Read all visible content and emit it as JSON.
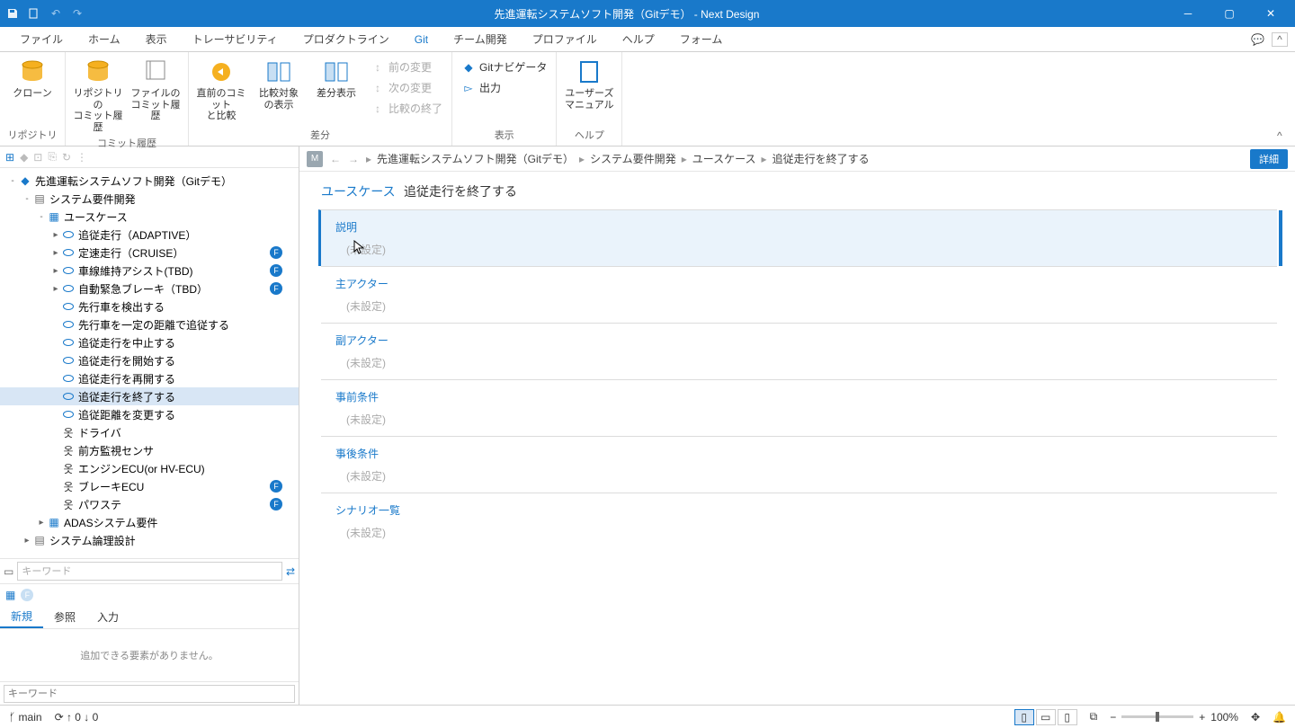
{
  "window": {
    "title": "先進運転システムソフト開発（Gitデモ） - Next Design"
  },
  "menu": {
    "tabs": [
      "ファイル",
      "ホーム",
      "表示",
      "トレーサビリティ",
      "プロダクトライン",
      "Git",
      "チーム開発",
      "プロファイル",
      "ヘルプ",
      "フォーム"
    ],
    "active": 5
  },
  "ribbon": {
    "groups": [
      {
        "label": "リポジトリ",
        "big": [
          {
            "label": "クローン"
          }
        ]
      },
      {
        "label": "コミット履歴",
        "big": [
          {
            "label": "リポジトリの\nコミット履歴"
          },
          {
            "label": "ファイルの\nコミット履歴"
          }
        ]
      },
      {
        "label": "差分",
        "big": [
          {
            "label": "直前のコミット\nと比較"
          },
          {
            "label": "比較対象\nの表示"
          },
          {
            "label": "差分表示"
          }
        ],
        "small": [
          {
            "label": "前の変更",
            "disabled": true
          },
          {
            "label": "次の変更",
            "disabled": true
          },
          {
            "label": "比較の終了",
            "disabled": true
          }
        ]
      },
      {
        "label": "表示",
        "small": [
          {
            "label": "Gitナビゲータ"
          },
          {
            "label": "出力"
          }
        ]
      },
      {
        "label": "ヘルプ",
        "big": [
          {
            "label": "ユーザーズ\nマニュアル"
          }
        ]
      }
    ]
  },
  "tree": [
    {
      "d": 0,
      "tw": "-",
      "ic": "proj",
      "label": "先進運転システムソフト開発（Gitデモ）"
    },
    {
      "d": 1,
      "tw": "-",
      "ic": "folder",
      "label": "システム要件開発"
    },
    {
      "d": 2,
      "tw": "-",
      "ic": "box",
      "label": "ユースケース"
    },
    {
      "d": 3,
      "tw": "▸",
      "ic": "oval",
      "label": "追従走行（ADAPTIVE）"
    },
    {
      "d": 3,
      "tw": "▸",
      "ic": "oval",
      "label": "定速走行（CRUISE）",
      "badge": "F"
    },
    {
      "d": 3,
      "tw": "▸",
      "ic": "oval",
      "label": "車線維持アシスト(TBD)",
      "badge": "F"
    },
    {
      "d": 3,
      "tw": "▸",
      "ic": "oval",
      "label": "自動緊急ブレーキ（TBD）",
      "badge": "F"
    },
    {
      "d": 3,
      "tw": "",
      "ic": "oval",
      "label": "先行車を検出する"
    },
    {
      "d": 3,
      "tw": "",
      "ic": "oval",
      "label": "先行車を一定の距離で追従する"
    },
    {
      "d": 3,
      "tw": "",
      "ic": "oval",
      "label": "追従走行を中止する"
    },
    {
      "d": 3,
      "tw": "",
      "ic": "oval",
      "label": "追従走行を開始する"
    },
    {
      "d": 3,
      "tw": "",
      "ic": "oval",
      "label": "追従走行を再開する"
    },
    {
      "d": 3,
      "tw": "",
      "ic": "oval",
      "label": "追従走行を終了する",
      "selected": true
    },
    {
      "d": 3,
      "tw": "",
      "ic": "oval",
      "label": "追従距離を変更する"
    },
    {
      "d": 3,
      "tw": "",
      "ic": "actor",
      "label": "ドライバ"
    },
    {
      "d": 3,
      "tw": "",
      "ic": "actor",
      "label": "前方監視センサ"
    },
    {
      "d": 3,
      "tw": "",
      "ic": "actor",
      "label": "エンジンECU(or HV-ECU)"
    },
    {
      "d": 3,
      "tw": "",
      "ic": "actor",
      "label": "ブレーキECU",
      "badge": "F"
    },
    {
      "d": 3,
      "tw": "",
      "ic": "actor",
      "label": "パワステ",
      "badge": "F"
    },
    {
      "d": 2,
      "tw": "▸",
      "ic": "box",
      "label": "ADASシステム要件"
    },
    {
      "d": 1,
      "tw": "▸",
      "ic": "folder",
      "label": "システム論理設計"
    }
  ],
  "search": {
    "placeholder": "キーワード"
  },
  "addpanel": {
    "tabs": [
      "新規",
      "参照",
      "入力"
    ],
    "active": 0,
    "empty": "追加できる要素がありません。",
    "placeholder": "キーワード"
  },
  "breadcrumb": [
    "先進運転システムソフト開発（Gitデモ）",
    "システム要件開発",
    "ユースケース",
    "追従走行を終了する"
  ],
  "detail_btn": "詳細",
  "page": {
    "category": "ユースケース",
    "title": "追従走行を終了する",
    "sections": [
      {
        "label": "説明",
        "value": "(未設定)",
        "active": true
      },
      {
        "label": "主アクター",
        "value": "(未設定)"
      },
      {
        "label": "副アクター",
        "value": "(未設定)"
      },
      {
        "label": "事前条件",
        "value": "(未設定)"
      },
      {
        "label": "事後条件",
        "value": "(未設定)"
      },
      {
        "label": "シナリオ一覧",
        "value": "(未設定)"
      }
    ]
  },
  "status": {
    "branch": "main",
    "sync": "↑ 0 ↓ 0",
    "zoom": "100%"
  }
}
